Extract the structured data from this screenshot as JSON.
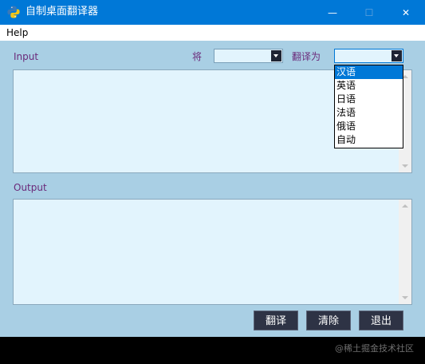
{
  "window": {
    "title": "自制桌面翻译器",
    "minimize_glyph": "—",
    "maximize_glyph": "☐",
    "close_glyph": "✕",
    "icon": "python-icon"
  },
  "menu": {
    "help_label": "Help"
  },
  "toolbar": {
    "from_label": "将",
    "to_label": "翻译为",
    "source_language_value": "",
    "target_language_value": ""
  },
  "input": {
    "label": "Input",
    "value": ""
  },
  "output": {
    "label": "Output",
    "value": ""
  },
  "dropdown": {
    "options": [
      "汉语",
      "英语",
      "日语",
      "法语",
      "俄语",
      "自动"
    ],
    "highlighted": "汉语"
  },
  "buttons": {
    "translate_label": "翻译",
    "clear_label": "清除",
    "exit_label": "退出"
  },
  "watermark": "@稀土掘金技术社区",
  "colors": {
    "titlebar": "#0078d7",
    "window_bg": "#a9cfe4",
    "field_bg": "#e2f4fd",
    "label_text": "#6b2a7a",
    "button_bg": "#2e3345"
  }
}
